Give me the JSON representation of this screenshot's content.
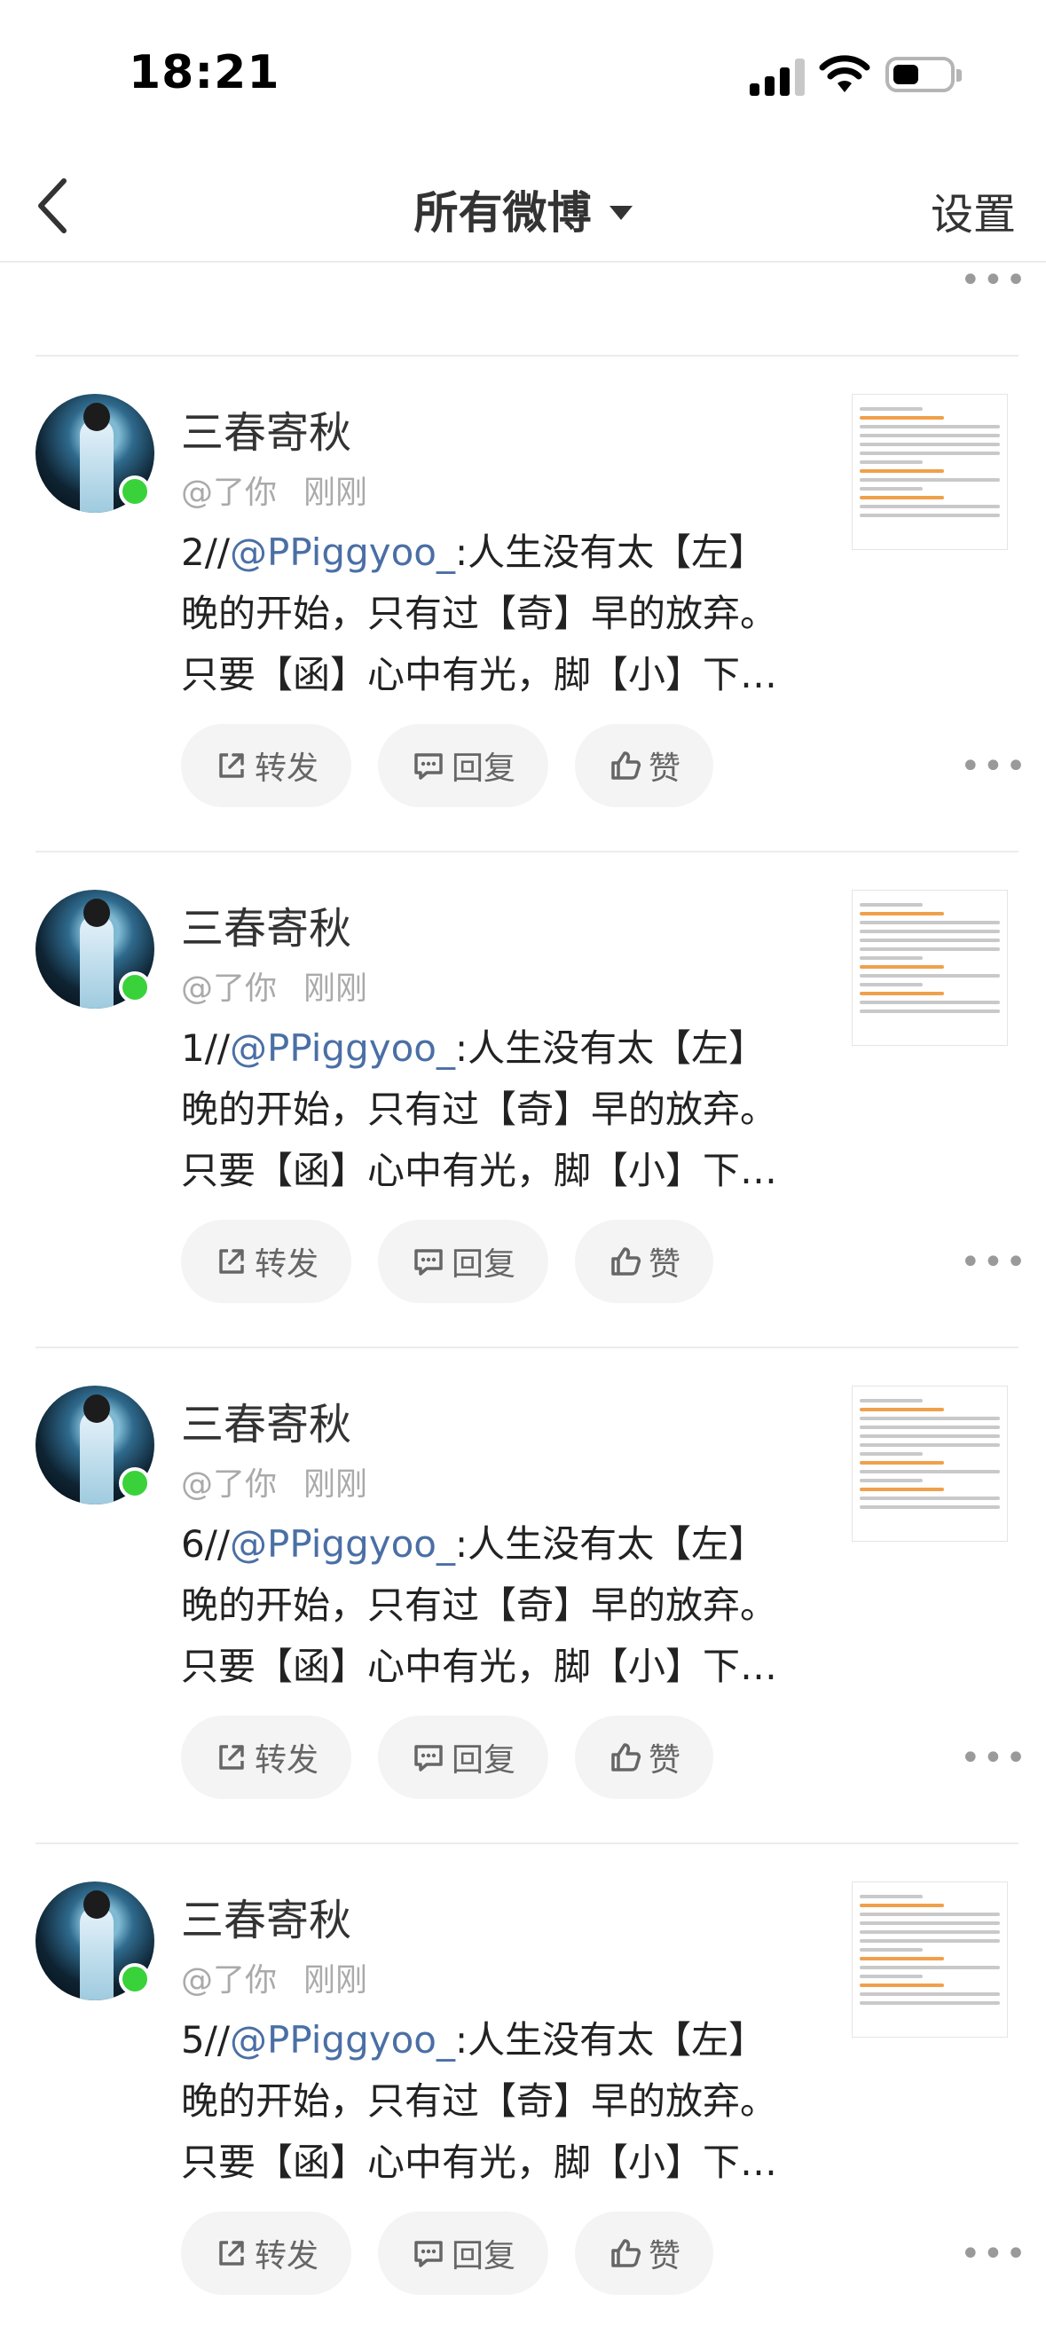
{
  "status_bar": {
    "time": "18:21"
  },
  "nav": {
    "title": "所有微博",
    "settings": "设置"
  },
  "more_symbol": "•••",
  "posts": [
    {
      "name": "三春寄秋",
      "handle": "@了你",
      "time": "刚刚",
      "prefix": "2//",
      "mention": "@PPiggyoo_",
      "line1": ":人生没有太【左】",
      "line2": "晚的开始，只有过【奇】早的放弃。",
      "line3": "只要【函】心中有光，脚【小】下…"
    },
    {
      "name": "三春寄秋",
      "handle": "@了你",
      "time": "刚刚",
      "prefix": "1//",
      "mention": "@PPiggyoo_",
      "line1": ":人生没有太【左】",
      "line2": "晚的开始，只有过【奇】早的放弃。",
      "line3": "只要【函】心中有光，脚【小】下…"
    },
    {
      "name": "三春寄秋",
      "handle": "@了你",
      "time": "刚刚",
      "prefix": "6//",
      "mention": "@PPiggyoo_",
      "line1": ":人生没有太【左】",
      "line2": "晚的开始，只有过【奇】早的放弃。",
      "line3": "只要【函】心中有光，脚【小】下…"
    },
    {
      "name": "三春寄秋",
      "handle": "@了你",
      "time": "刚刚",
      "prefix": "5//",
      "mention": "@PPiggyoo_",
      "line1": ":人生没有太【左】",
      "line2": "晚的开始，只有过【奇】早的放弃。",
      "line3": "只要【函】心中有光，脚【小】下…"
    }
  ],
  "actions": {
    "share": "转发",
    "reply": "回复",
    "like": "赞"
  }
}
